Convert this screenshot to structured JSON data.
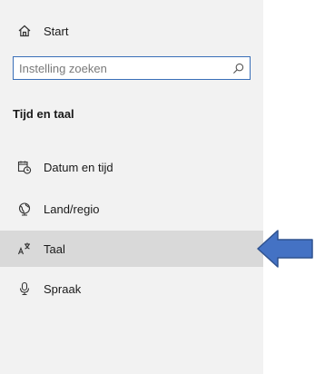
{
  "nav": {
    "start": {
      "label": "Start",
      "icon": "home-icon"
    },
    "search": {
      "placeholder": "Instelling zoeken",
      "value": "",
      "icon": "search-icon"
    },
    "section_title": "Tijd en taal",
    "items": [
      {
        "label": "Datum en tijd",
        "icon": "calendar-clock-icon",
        "selected": false
      },
      {
        "label": "Land/regio",
        "icon": "globe-icon",
        "selected": false
      },
      {
        "label": "Taal",
        "icon": "language-icon",
        "selected": true
      },
      {
        "label": "Spraak",
        "icon": "microphone-icon",
        "selected": false
      }
    ]
  },
  "colors": {
    "sidebar_bg": "#f2f2f2",
    "selected_bg": "#d9d9d9",
    "search_border": "#3a6fb8",
    "arrow_fill": "#4472c4",
    "arrow_stroke": "#2f528f"
  }
}
